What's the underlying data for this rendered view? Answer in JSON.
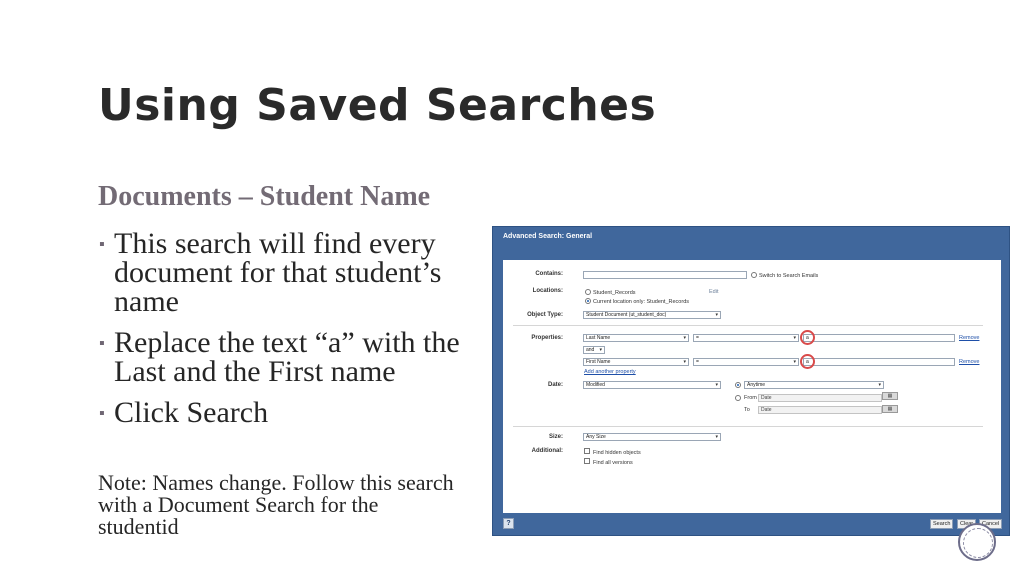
{
  "slide": {
    "title": "Using Saved Searches",
    "subtitle": "Documents – Student Name",
    "bullets": [
      "This search will find every document for that student’s name",
      "Replace the text “a” with the Last and the First name",
      "Click Search"
    ],
    "note": "Note:  Names change. Follow this search with a Document Search for the studentid"
  },
  "dialog": {
    "title": "Advanced Search: General",
    "contains_label": "Contains:",
    "switch_emails_label": "Switch to Search Emails",
    "locations_label": "Locations:",
    "location_option_1": "Student_Records",
    "location_option_2": "Current location only: Student_Records",
    "edit_link": "Edit",
    "object_type_label": "Object Type:",
    "object_type_value": "Student Document (ut_student_doc)",
    "properties_label": "Properties:",
    "prop1_field": "Last Name",
    "prop1_operator": "=",
    "prop1_value": "a",
    "conjunction": "and",
    "prop2_field": "First Name",
    "prop2_operator": "=",
    "prop2_value": "a",
    "remove_label": "Remove",
    "add_property_link": "Add another property",
    "date_label": "Date:",
    "date_field": "Modified",
    "date_anytime": "Anytime",
    "from_label": "From",
    "to_label": "To",
    "date_placeholder": "Date",
    "size_label": "Size:",
    "size_value": "Any Size",
    "additional_label": "Additional:",
    "find_hidden": "Find hidden objects",
    "find_versions": "Find all versions",
    "help_label": "?",
    "search_button": "Search",
    "clear_button": "Clear",
    "cancel_button": "Cancel"
  },
  "colors": {
    "dialog_frame": "#40679c",
    "highlight_circle": "#d94a4a",
    "subtitle": "#736b75"
  }
}
